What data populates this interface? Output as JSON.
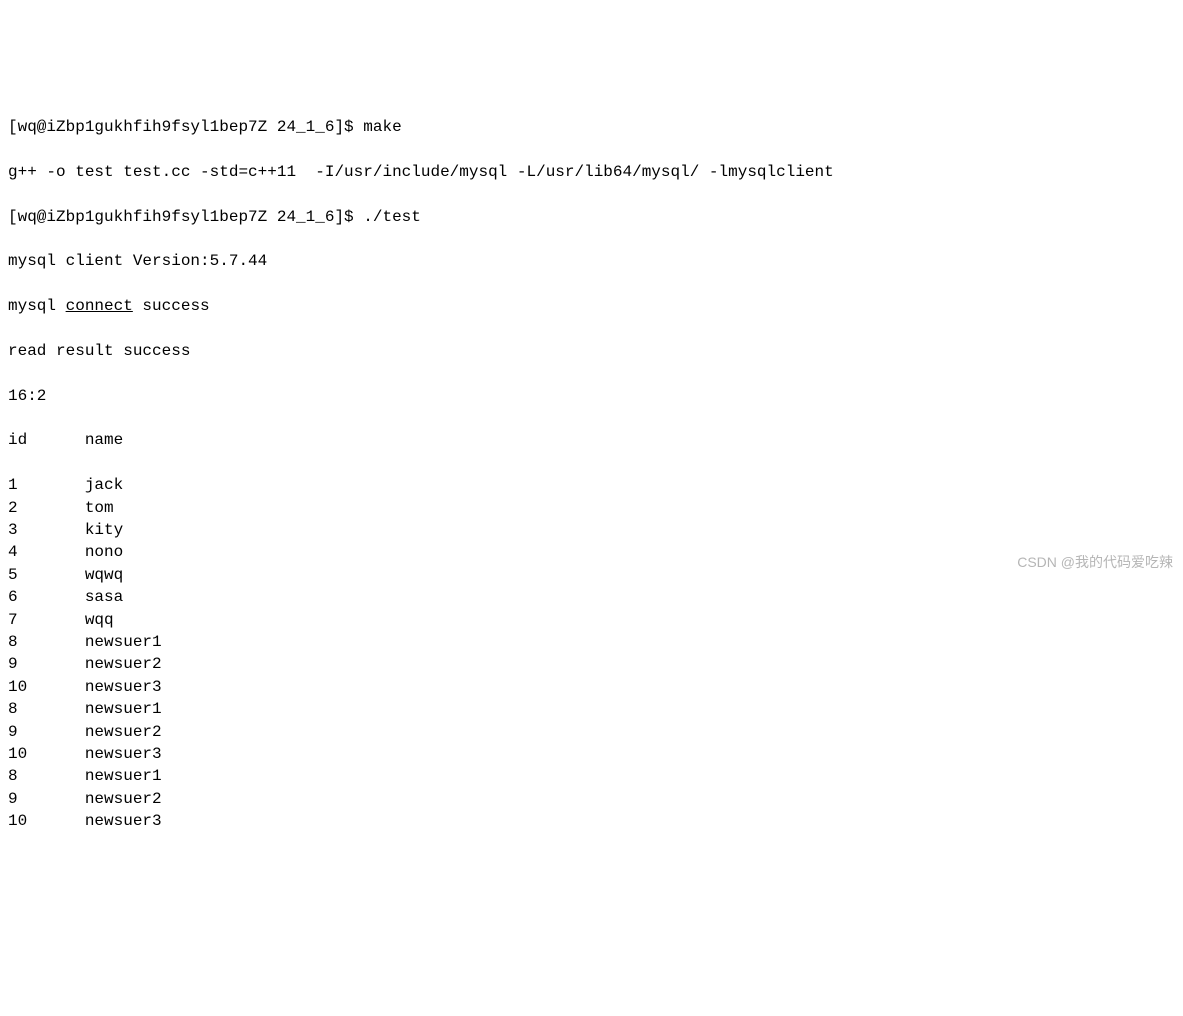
{
  "prompt1": {
    "prefix": "[wq@iZbp1gukhfih9fsyl1bep7Z 24_1_6]$ ",
    "command": "make"
  },
  "compile_line": "g++ -o test test.cc -std=c++11  -I/usr/include/mysql -L/usr/lib64/mysql/ -lmysqlclient",
  "prompt2": {
    "prefix": "[wq@iZbp1gukhfih9fsyl1bep7Z 24_1_6]$ ",
    "command": "./test"
  },
  "version_line": "mysql client Version:5.7.44",
  "connect_line": {
    "before": "mysql ",
    "underlined": "connect",
    "after": " success"
  },
  "read_line": "read result success",
  "dims": "16:2",
  "header": {
    "id": "id",
    "name": "name"
  },
  "rows": [
    {
      "id": "1",
      "name": "jack"
    },
    {
      "id": "2",
      "name": "tom"
    },
    {
      "id": "3",
      "name": "kity"
    },
    {
      "id": "4",
      "name": "nono"
    },
    {
      "id": "5",
      "name": "wqwq"
    },
    {
      "id": "6",
      "name": "sasa"
    },
    {
      "id": "7",
      "name": "wqq"
    },
    {
      "id": "8",
      "name": "newsuer1"
    },
    {
      "id": "9",
      "name": "newsuer2"
    },
    {
      "id": "10",
      "name": "newsuer3"
    },
    {
      "id": "8",
      "name": "newsuer1"
    },
    {
      "id": "9",
      "name": "newsuer2"
    },
    {
      "id": "10",
      "name": "newsuer3"
    },
    {
      "id": "8",
      "name": "newsuer1"
    },
    {
      "id": "9",
      "name": "newsuer2"
    },
    {
      "id": "10",
      "name": "newsuer3"
    }
  ],
  "watermark": "CSDN @我的代码爱吃辣"
}
